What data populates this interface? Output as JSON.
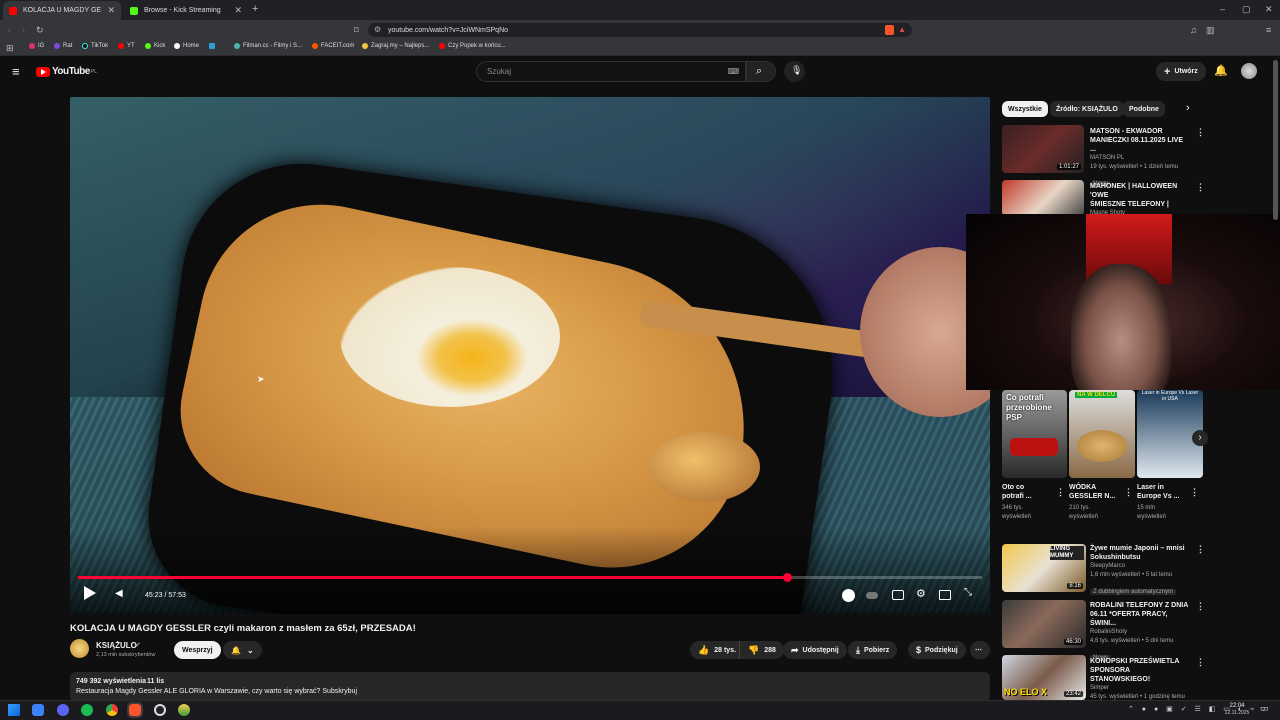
{
  "browser": {
    "tabs": [
      {
        "title": "KOLACJA U MAGDY GESSLER",
        "active": true
      },
      {
        "title": "Browse - Kick Streaming",
        "active": false
      }
    ],
    "url": "youtube.com/watch?v=JciWNmSPqNo",
    "bookmarks": [
      "IG",
      "Rat",
      "TikTok",
      "YT",
      "Kick",
      "Home",
      "",
      "Filman.cc - Filmy i S...",
      "FACEIT.com",
      "Zagraj.my – Najleps...",
      "Czy Popek w końcu..."
    ]
  },
  "youtube": {
    "logo": "YouTube",
    "country": "PL",
    "search_placeholder": "Szukaj",
    "create_label": "Utwórz"
  },
  "player": {
    "time": "45:23 / 57:53",
    "progress": 0.784
  },
  "video": {
    "title": "KOLACJA U MAGDY GESSLER czyli makaron z masłem za 65zł, PRZESADA!",
    "channel": "KSIĄŻULO",
    "subscribers": "2,13 mln subskrybentów",
    "support_label": "Wesprzyj",
    "likes": "28 tys.",
    "dislikes": "288",
    "share_label": "Udostępnij",
    "download_label": "Pobierz",
    "thanks_label": "Podziękuj",
    "views": "749 392 wyświetlenia",
    "date": "11 lis",
    "description": "Restauracja Magdy Gessler ALE GLORIA w Warszawie, czy warto się wybrać? Subskrybuj"
  },
  "sidebar": {
    "chips": [
      "Wszystkie",
      "Źródło: KSIĄŻULO",
      "Podobne"
    ],
    "recs_top": [
      {
        "title1": "MATSON - EKWADOR",
        "title2": "MANIECZKI 08.11.2025 LIVE ...",
        "channel": "MATSON PL",
        "meta": "19 tys. wyświetleń • 1 dzień temu",
        "badge": "Nowy",
        "duration": "1:01:27"
      },
      {
        "title1": "MAHONEK | HALLOWEEN 'OWE",
        "title2": "ŚMIESZNE TELEFONY |",
        "channel": "Masne Shoty",
        "meta": "",
        "badge": "",
        "duration": ""
      }
    ],
    "shorts": [
      {
        "t1": "Oto co",
        "t2": "potrafi ...",
        "views1": "346 tys.",
        "views2": "wyświetleń",
        "caption": "Co potrafi przerobione PSP"
      },
      {
        "t1": "WÓDKA",
        "t2": "GESSLER N...",
        "views1": "210 tys.",
        "views2": "wyświetleń",
        "caption": "NA W DELCU"
      },
      {
        "t1": "Laser in",
        "t2": "Europe Vs ...",
        "views1": "15 mln",
        "views2": "wyświetleń",
        "caption": "Laser in Europe Vs Laser in USA"
      }
    ],
    "recs_bottom": [
      {
        "title1": "Żywe mumie Japonii – mnisi",
        "title2": "Sokushinbutsu",
        "channel": "SleepyMarco",
        "meta": "1,6 mln wyświetleń • 5 lat temu",
        "badge": "Z dubbingiem automatycznym",
        "duration": "8:16",
        "caption": "LIVING MUMMY"
      },
      {
        "title1": "ROBALINI TELEFONY Z DNIA",
        "title2": "06.11 *OFERTA PRACY, ŚWINI...",
        "channel": "RobaliniShoty",
        "meta": "4,6 tys. wyświetleń • 5 dni temu",
        "badge": "Nowy",
        "duration": "46:30",
        "caption": ""
      },
      {
        "title1": "KONOPSKI PRZEŚWIETLA",
        "title2": "SPONSORA STANOWSKIEGO!",
        "channel": "Simper",
        "meta": "45 tys. wyświetleń • 1 godzinę temu",
        "badge": "",
        "duration": "23:42",
        "caption": "NO ELO X"
      }
    ]
  },
  "taskbar": {
    "time": "22:04",
    "date": "12.11.2025"
  },
  "colors": {
    "progress": "#ff0033",
    "bg": "#0f0f0f",
    "chip_active": "#f1f1f1"
  }
}
